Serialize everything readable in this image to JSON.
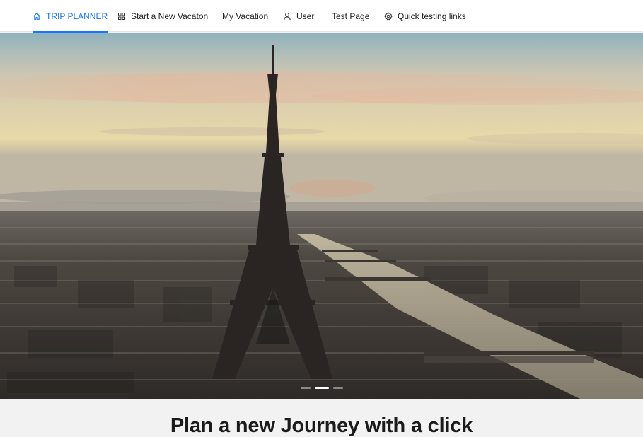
{
  "nav": {
    "items": [
      {
        "label": "TRIP PLANNER",
        "icon": "home-icon",
        "active": true
      },
      {
        "label": "Start a New Vacaton",
        "icon": "grid-icon",
        "active": false
      },
      {
        "label": "My Vacation",
        "icon": "",
        "active": false
      },
      {
        "label": "User",
        "icon": "user-icon",
        "active": false
      },
      {
        "label": "Test Page",
        "icon": "",
        "active": false
      },
      {
        "label": "Quick testing links",
        "icon": "gear-icon",
        "active": false
      }
    ]
  },
  "hero": {
    "image": "paris-eiffel-tower-sunset",
    "slide_count": 3,
    "active_slide": 2
  },
  "headline": "Plan a new Journey with a click",
  "colors": {
    "accent": "#1677ff",
    "nav_bg": "#ffffff",
    "section_bg": "#f2f2f2",
    "text": "#1b1b1b"
  }
}
